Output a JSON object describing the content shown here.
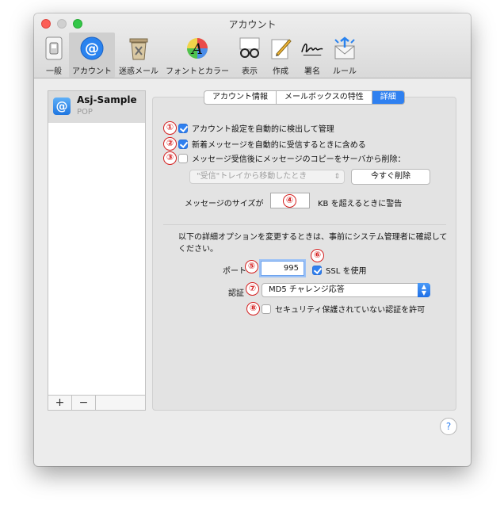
{
  "window": {
    "title": "アカウント"
  },
  "toolbar": {
    "items": [
      {
        "label": "一般",
        "icon": "switch-icon"
      },
      {
        "label": "アカウント",
        "icon": "at-icon"
      },
      {
        "label": "迷惑メール",
        "icon": "trash-icon"
      },
      {
        "label": "フォントとカラー",
        "icon": "font-color-icon"
      },
      {
        "label": "表示",
        "icon": "glasses-icon"
      },
      {
        "label": "作成",
        "icon": "pencil-icon"
      },
      {
        "label": "署名",
        "icon": "signature-icon"
      },
      {
        "label": "ルール",
        "icon": "rules-envelope-icon"
      }
    ],
    "selected": "アカウント"
  },
  "sidebar": {
    "accounts": [
      {
        "name": "Asj-Sample",
        "type": "POP"
      }
    ],
    "add_label": "+",
    "remove_label": "−"
  },
  "tabs": [
    {
      "label": "アカウント情報"
    },
    {
      "label": "メールボックスの特性"
    },
    {
      "label": "詳細"
    }
  ],
  "advanced": {
    "auto_detect": {
      "marker": "①",
      "label": "アカウント設定を自動的に検出して管理",
      "checked": true
    },
    "include_auto_receive": {
      "marker": "②",
      "label": "新着メッセージを自動的に受信するときに含める",
      "checked": true
    },
    "remove_copy": {
      "marker": "③",
      "label": "メッセージ受信後にメッセージのコピーをサーバから削除：",
      "checked": false
    },
    "remove_timing": {
      "value": "\"受信\"トレイから移動したとき"
    },
    "remove_now_label": "今すぐ削除",
    "size_warning": {
      "prefix": "メッセージのサイズが",
      "marker": "④",
      "suffix": "KB を超えるときに警告"
    },
    "admin_note": "以下の詳細オプションを変更するときは、事前にシステム管理者に確認してください。",
    "port": {
      "label": "ポート",
      "marker": "⑤",
      "value": "995"
    },
    "ssl": {
      "marker": "⑥",
      "label": "SSL を使用",
      "checked": true
    },
    "auth": {
      "label": "認証",
      "marker": "⑦",
      "value": "MD5 チャレンジ応答"
    },
    "insecure_auth": {
      "marker": "⑧",
      "label": "セキュリティ保護されていない認証を許可",
      "checked": false
    }
  },
  "help_label": "?",
  "colors": {
    "accent": "#2f80f0",
    "marker": "#d52020"
  }
}
